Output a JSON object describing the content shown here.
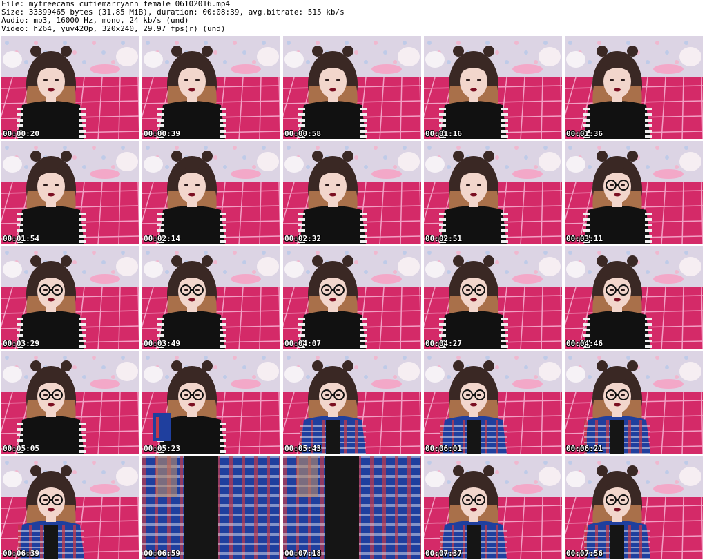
{
  "header": {
    "file_line": "File: myfreecams_cutiemarryann_female_06102016.mp4",
    "size_line": "Size: 33399465 bytes (31.85 MiB), duration: 00:08:39, avg.bitrate: 515 kb/s",
    "audio_line": "Audio: mp3, 16000 Hz, mono, 24 kb/s (und)",
    "video_line": "Video: h264, yuv420p, 320x240, 29.97 fps(r) (und)"
  },
  "thumbnails": [
    {
      "timestamp": "00:00:20",
      "glasses": false,
      "outfit": "striped"
    },
    {
      "timestamp": "00:00:39",
      "glasses": false,
      "outfit": "striped"
    },
    {
      "timestamp": "00:00:58",
      "glasses": false,
      "outfit": "striped"
    },
    {
      "timestamp": "00:01:16",
      "glasses": false,
      "outfit": "striped"
    },
    {
      "timestamp": "00:01:36",
      "glasses": false,
      "outfit": "striped"
    },
    {
      "timestamp": "00:01:54",
      "glasses": false,
      "outfit": "striped"
    },
    {
      "timestamp": "00:02:14",
      "glasses": false,
      "outfit": "striped"
    },
    {
      "timestamp": "00:02:32",
      "glasses": false,
      "outfit": "striped"
    },
    {
      "timestamp": "00:02:51",
      "glasses": false,
      "outfit": "striped"
    },
    {
      "timestamp": "00:03:11",
      "glasses": true,
      "outfit": "striped"
    },
    {
      "timestamp": "00:03:29",
      "glasses": true,
      "outfit": "striped"
    },
    {
      "timestamp": "00:03:49",
      "glasses": true,
      "outfit": "striped"
    },
    {
      "timestamp": "00:04:07",
      "glasses": true,
      "outfit": "striped"
    },
    {
      "timestamp": "00:04:27",
      "glasses": true,
      "outfit": "striped"
    },
    {
      "timestamp": "00:04:46",
      "glasses": true,
      "outfit": "striped"
    },
    {
      "timestamp": "00:05:05",
      "glasses": true,
      "outfit": "striped"
    },
    {
      "timestamp": "00:05:23",
      "glasses": true,
      "outfit": "black"
    },
    {
      "timestamp": "00:05:43",
      "glasses": true,
      "outfit": "plaid"
    },
    {
      "timestamp": "00:06:01",
      "glasses": true,
      "outfit": "plaid"
    },
    {
      "timestamp": "00:06:21",
      "glasses": true,
      "outfit": "plaid"
    },
    {
      "timestamp": "00:06:39",
      "glasses": true,
      "outfit": "plaid"
    },
    {
      "timestamp": "00:06:59",
      "glasses": false,
      "outfit": "closeup"
    },
    {
      "timestamp": "00:07:18",
      "glasses": false,
      "outfit": "closeup"
    },
    {
      "timestamp": "00:07:37",
      "glasses": true,
      "outfit": "plaid"
    },
    {
      "timestamp": "00:07:56",
      "glasses": true,
      "outfit": "plaid"
    }
  ],
  "colors": {
    "wall": "#dcd4e4",
    "bed": "#d42a68",
    "hair": "#3a2824",
    "skin": "#f2d6cc",
    "plaid": "#1f3f9e",
    "top": "#111111",
    "timestamp_text": "#ffffff"
  }
}
